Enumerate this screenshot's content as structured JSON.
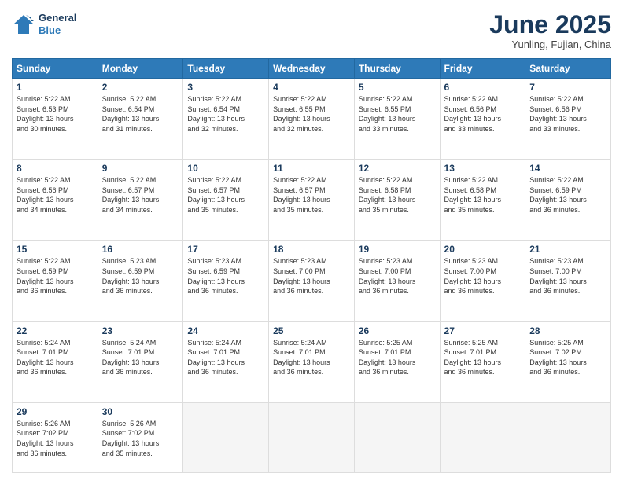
{
  "header": {
    "logo_line1": "General",
    "logo_line2": "Blue",
    "month_title": "June 2025",
    "location": "Yunling, Fujian, China"
  },
  "weekdays": [
    "Sunday",
    "Monday",
    "Tuesday",
    "Wednesday",
    "Thursday",
    "Friday",
    "Saturday"
  ],
  "weeks": [
    [
      {
        "day": 1,
        "info": "Sunrise: 5:22 AM\nSunset: 6:53 PM\nDaylight: 13 hours\nand 30 minutes."
      },
      {
        "day": 2,
        "info": "Sunrise: 5:22 AM\nSunset: 6:54 PM\nDaylight: 13 hours\nand 31 minutes."
      },
      {
        "day": 3,
        "info": "Sunrise: 5:22 AM\nSunset: 6:54 PM\nDaylight: 13 hours\nand 32 minutes."
      },
      {
        "day": 4,
        "info": "Sunrise: 5:22 AM\nSunset: 6:55 PM\nDaylight: 13 hours\nand 32 minutes."
      },
      {
        "day": 5,
        "info": "Sunrise: 5:22 AM\nSunset: 6:55 PM\nDaylight: 13 hours\nand 33 minutes."
      },
      {
        "day": 6,
        "info": "Sunrise: 5:22 AM\nSunset: 6:56 PM\nDaylight: 13 hours\nand 33 minutes."
      },
      {
        "day": 7,
        "info": "Sunrise: 5:22 AM\nSunset: 6:56 PM\nDaylight: 13 hours\nand 33 minutes."
      }
    ],
    [
      {
        "day": 8,
        "info": "Sunrise: 5:22 AM\nSunset: 6:56 PM\nDaylight: 13 hours\nand 34 minutes."
      },
      {
        "day": 9,
        "info": "Sunrise: 5:22 AM\nSunset: 6:57 PM\nDaylight: 13 hours\nand 34 minutes."
      },
      {
        "day": 10,
        "info": "Sunrise: 5:22 AM\nSunset: 6:57 PM\nDaylight: 13 hours\nand 35 minutes."
      },
      {
        "day": 11,
        "info": "Sunrise: 5:22 AM\nSunset: 6:57 PM\nDaylight: 13 hours\nand 35 minutes."
      },
      {
        "day": 12,
        "info": "Sunrise: 5:22 AM\nSunset: 6:58 PM\nDaylight: 13 hours\nand 35 minutes."
      },
      {
        "day": 13,
        "info": "Sunrise: 5:22 AM\nSunset: 6:58 PM\nDaylight: 13 hours\nand 35 minutes."
      },
      {
        "day": 14,
        "info": "Sunrise: 5:22 AM\nSunset: 6:59 PM\nDaylight: 13 hours\nand 36 minutes."
      }
    ],
    [
      {
        "day": 15,
        "info": "Sunrise: 5:22 AM\nSunset: 6:59 PM\nDaylight: 13 hours\nand 36 minutes."
      },
      {
        "day": 16,
        "info": "Sunrise: 5:23 AM\nSunset: 6:59 PM\nDaylight: 13 hours\nand 36 minutes."
      },
      {
        "day": 17,
        "info": "Sunrise: 5:23 AM\nSunset: 6:59 PM\nDaylight: 13 hours\nand 36 minutes."
      },
      {
        "day": 18,
        "info": "Sunrise: 5:23 AM\nSunset: 7:00 PM\nDaylight: 13 hours\nand 36 minutes."
      },
      {
        "day": 19,
        "info": "Sunrise: 5:23 AM\nSunset: 7:00 PM\nDaylight: 13 hours\nand 36 minutes."
      },
      {
        "day": 20,
        "info": "Sunrise: 5:23 AM\nSunset: 7:00 PM\nDaylight: 13 hours\nand 36 minutes."
      },
      {
        "day": 21,
        "info": "Sunrise: 5:23 AM\nSunset: 7:00 PM\nDaylight: 13 hours\nand 36 minutes."
      }
    ],
    [
      {
        "day": 22,
        "info": "Sunrise: 5:24 AM\nSunset: 7:01 PM\nDaylight: 13 hours\nand 36 minutes."
      },
      {
        "day": 23,
        "info": "Sunrise: 5:24 AM\nSunset: 7:01 PM\nDaylight: 13 hours\nand 36 minutes."
      },
      {
        "day": 24,
        "info": "Sunrise: 5:24 AM\nSunset: 7:01 PM\nDaylight: 13 hours\nand 36 minutes."
      },
      {
        "day": 25,
        "info": "Sunrise: 5:24 AM\nSunset: 7:01 PM\nDaylight: 13 hours\nand 36 minutes."
      },
      {
        "day": 26,
        "info": "Sunrise: 5:25 AM\nSunset: 7:01 PM\nDaylight: 13 hours\nand 36 minutes."
      },
      {
        "day": 27,
        "info": "Sunrise: 5:25 AM\nSunset: 7:01 PM\nDaylight: 13 hours\nand 36 minutes."
      },
      {
        "day": 28,
        "info": "Sunrise: 5:25 AM\nSunset: 7:02 PM\nDaylight: 13 hours\nand 36 minutes."
      }
    ],
    [
      {
        "day": 29,
        "info": "Sunrise: 5:26 AM\nSunset: 7:02 PM\nDaylight: 13 hours\nand 36 minutes."
      },
      {
        "day": 30,
        "info": "Sunrise: 5:26 AM\nSunset: 7:02 PM\nDaylight: 13 hours\nand 35 minutes."
      },
      null,
      null,
      null,
      null,
      null
    ]
  ]
}
